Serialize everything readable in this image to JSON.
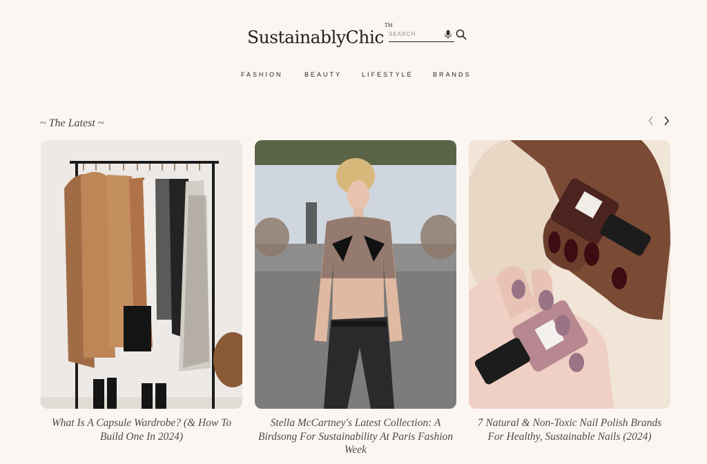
{
  "header": {
    "logo_text": "SustainablyChic",
    "logo_tm": "TM",
    "search_placeholder": "SEARCH"
  },
  "nav": {
    "items": [
      "FASHION",
      "BEAUTY",
      "LIFESTYLE",
      "BRANDS"
    ]
  },
  "latest": {
    "title": "~ The Latest ~",
    "cards": [
      {
        "caption": "What Is A Capsule Wardrobe? (& How To Build One In 2024)"
      },
      {
        "caption": "Stella McCartney's Latest Collection: A Birdsong For Sustainability At Paris Fashion Week"
      },
      {
        "caption": "7 Natural & Non-Toxic Nail Polish Brands For Healthy, Sustainable Nails (2024)"
      }
    ]
  }
}
